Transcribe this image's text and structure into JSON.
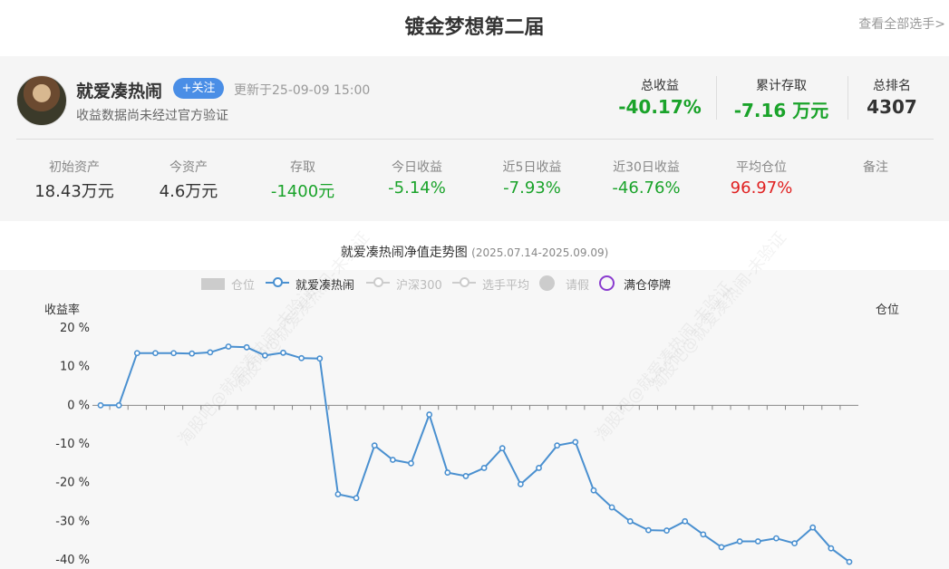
{
  "header": {
    "title": "镀金梦想第二届",
    "view_all": "查看全部选手>"
  },
  "profile": {
    "username": "就爱凑热闹",
    "follow_label": "+关注",
    "updated": "更新于25-09-09 15:00",
    "verify_note": "收益数据尚未经过官方验证",
    "summary": {
      "total_return": {
        "label": "总收益",
        "value": "-40.17%"
      },
      "cumulative_deposit": {
        "label": "累计存取",
        "value": "-7.16 万元"
      },
      "total_rank": {
        "label": "总排名",
        "value": "4307"
      }
    },
    "metrics": [
      {
        "label": "初始资产",
        "value": "18.43万元",
        "tone": "dark"
      },
      {
        "label": "今资产",
        "value": "4.6万元",
        "tone": "dark"
      },
      {
        "label": "存取",
        "value": "-1400元",
        "tone": "green"
      },
      {
        "label": "今日收益",
        "value": "-5.14%",
        "tone": "green"
      },
      {
        "label": "近5日收益",
        "value": "-7.93%",
        "tone": "green"
      },
      {
        "label": "近30日收益",
        "value": "-46.76%",
        "tone": "green"
      },
      {
        "label": "平均仓位",
        "value": "96.97%",
        "tone": "red"
      },
      {
        "label": "备注",
        "value": "",
        "tone": "dark"
      }
    ]
  },
  "watermark_text": "淘股吧@就爱凑热闹-未验证",
  "chart_data": {
    "type": "line",
    "title": "就爱凑热闹净值走势图",
    "subtitle": "(2025.07.14-2025.09.09)",
    "ylabel": "收益率",
    "y2label": "仓位",
    "ylim": [
      -40,
      20
    ],
    "yticks": [
      20,
      10,
      0,
      -10,
      -20,
      -30,
      -40
    ],
    "ytick_labels": [
      "20 %",
      "10 %",
      "0 %",
      "-10 %",
      "-20 %",
      "-30 %",
      "-40 %"
    ],
    "legend": [
      {
        "name": "仓位",
        "active": false
      },
      {
        "name": "就爱凑热闹",
        "active": true
      },
      {
        "name": "沪深300",
        "active": false
      },
      {
        "name": "选手平均",
        "active": false
      },
      {
        "name": "请假",
        "active": false
      },
      {
        "name": "满仓停牌",
        "active": true
      }
    ],
    "series": [
      {
        "name": "就爱凑热闹",
        "color": "#4a90d0",
        "values": [
          0,
          0,
          13.5,
          13.5,
          13.5,
          13.4,
          13.7,
          15.2,
          15.0,
          12.9,
          13.6,
          12.2,
          12.1,
          -23.0,
          -24.0,
          -10.4,
          -14.1,
          -15.0,
          -2.4,
          -17.4,
          -18.3,
          -16.2,
          -11.1,
          -20.4,
          -16.2,
          -10.4,
          -9.5,
          -22.0,
          -26.4,
          -30.0,
          -32.3,
          -32.4,
          -30.0,
          -33.4,
          -36.7,
          -35.2,
          -35.2,
          -34.4,
          -35.7,
          -31.6,
          -37.0,
          -40.5
        ]
      }
    ]
  }
}
